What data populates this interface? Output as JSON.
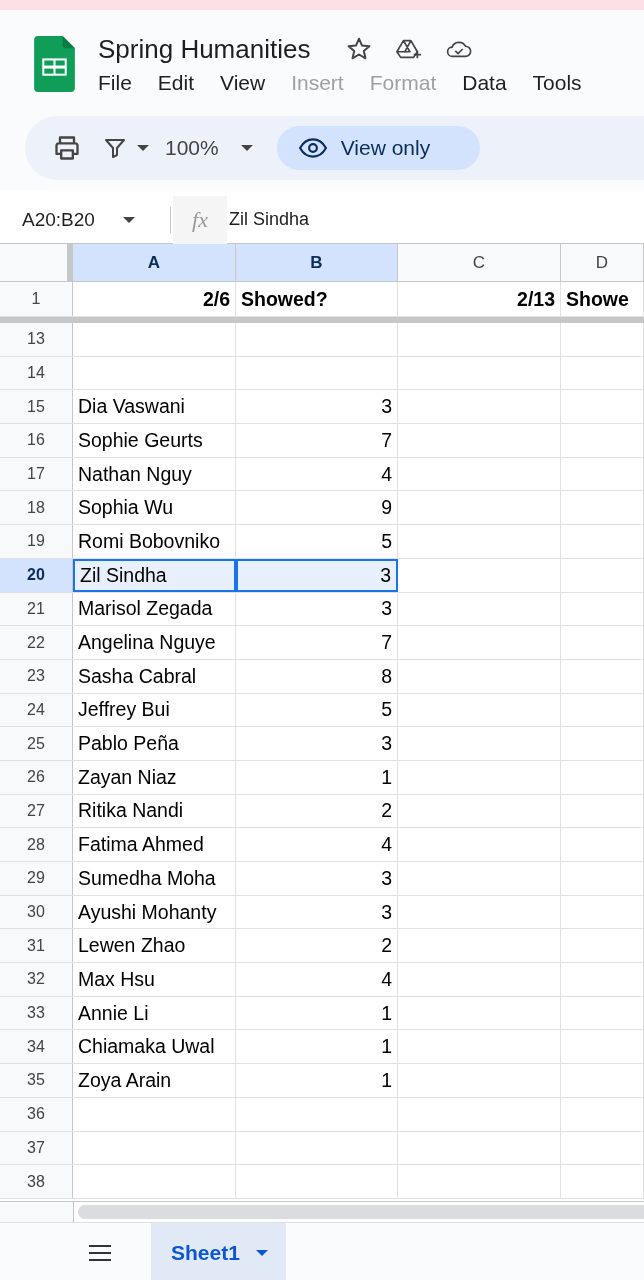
{
  "title": "Spring Humanities",
  "menu": [
    {
      "label": "File",
      "disabled": false
    },
    {
      "label": "Edit",
      "disabled": false
    },
    {
      "label": "View",
      "disabled": false
    },
    {
      "label": "Insert",
      "disabled": true
    },
    {
      "label": "Format",
      "disabled": true
    },
    {
      "label": "Data",
      "disabled": false
    },
    {
      "label": "Tools",
      "disabled": false
    }
  ],
  "toolbar": {
    "zoom": "100%",
    "mode_button": "View only"
  },
  "formula_bar": {
    "name_box": "A20:B20",
    "function_symbol": "fx",
    "value": "Zil Sindha"
  },
  "columns": [
    {
      "label": "A",
      "selected": true
    },
    {
      "label": "B",
      "selected": true
    },
    {
      "label": "C",
      "selected": false
    },
    {
      "label": "D",
      "selected": false
    }
  ],
  "frozen_row": {
    "number": "1",
    "cells": [
      "2/6",
      "Showed?",
      "2/13",
      "Showe"
    ]
  },
  "rows": [
    {
      "number": "13",
      "cells": [],
      "selected": false
    },
    {
      "number": "14",
      "cells": [],
      "selected": false
    },
    {
      "number": "15",
      "cells": [
        "Dia Vaswani",
        "3"
      ],
      "selected": false
    },
    {
      "number": "16",
      "cells": [
        "Sophie Geurts",
        "7"
      ],
      "selected": false
    },
    {
      "number": "17",
      "cells": [
        "Nathan Nguy",
        "4"
      ],
      "selected": false
    },
    {
      "number": "18",
      "cells": [
        "Sophia Wu",
        "9"
      ],
      "selected": false
    },
    {
      "number": "19",
      "cells": [
        "Romi Bobovniko",
        "5"
      ],
      "selected": false
    },
    {
      "number": "20",
      "cells": [
        "Zil Sindha",
        "3"
      ],
      "selected": true
    },
    {
      "number": "21",
      "cells": [
        "Marisol Zegada",
        "3"
      ],
      "selected": false
    },
    {
      "number": "22",
      "cells": [
        "Angelina Nguye",
        "7"
      ],
      "selected": false
    },
    {
      "number": "23",
      "cells": [
        "Sasha Cabral",
        "8"
      ],
      "selected": false
    },
    {
      "number": "24",
      "cells": [
        "Jeffrey Bui",
        "5"
      ],
      "selected": false
    },
    {
      "number": "25",
      "cells": [
        "Pablo Peña",
        "3"
      ],
      "selected": false
    },
    {
      "number": "26",
      "cells": [
        "Zayan Niaz",
        "1"
      ],
      "selected": false
    },
    {
      "number": "27",
      "cells": [
        "Ritika Nandi",
        "2"
      ],
      "selected": false
    },
    {
      "number": "28",
      "cells": [
        "Fatima Ahmed",
        "4"
      ],
      "selected": false
    },
    {
      "number": "29",
      "cells": [
        "Sumedha Moha",
        "3"
      ],
      "selected": false
    },
    {
      "number": "30",
      "cells": [
        "Ayushi Mohanty",
        "3"
      ],
      "selected": false
    },
    {
      "number": "31",
      "cells": [
        "Lewen Zhao",
        "2"
      ],
      "selected": false
    },
    {
      "number": "32",
      "cells": [
        "Max Hsu",
        "4"
      ],
      "selected": false
    },
    {
      "number": "33",
      "cells": [
        "Annie Li",
        "1"
      ],
      "selected": false
    },
    {
      "number": "34",
      "cells": [
        "Chiamaka Uwal",
        "1"
      ],
      "selected": false
    },
    {
      "number": "35",
      "cells": [
        "Zoya Arain",
        "1"
      ],
      "selected": false
    },
    {
      "number": "36",
      "cells": [],
      "selected": false
    },
    {
      "number": "37",
      "cells": [],
      "selected": false
    },
    {
      "number": "38",
      "cells": [],
      "selected": false
    }
  ],
  "sheet_tabs": [
    {
      "label": "Sheet1",
      "selected": true
    }
  ]
}
